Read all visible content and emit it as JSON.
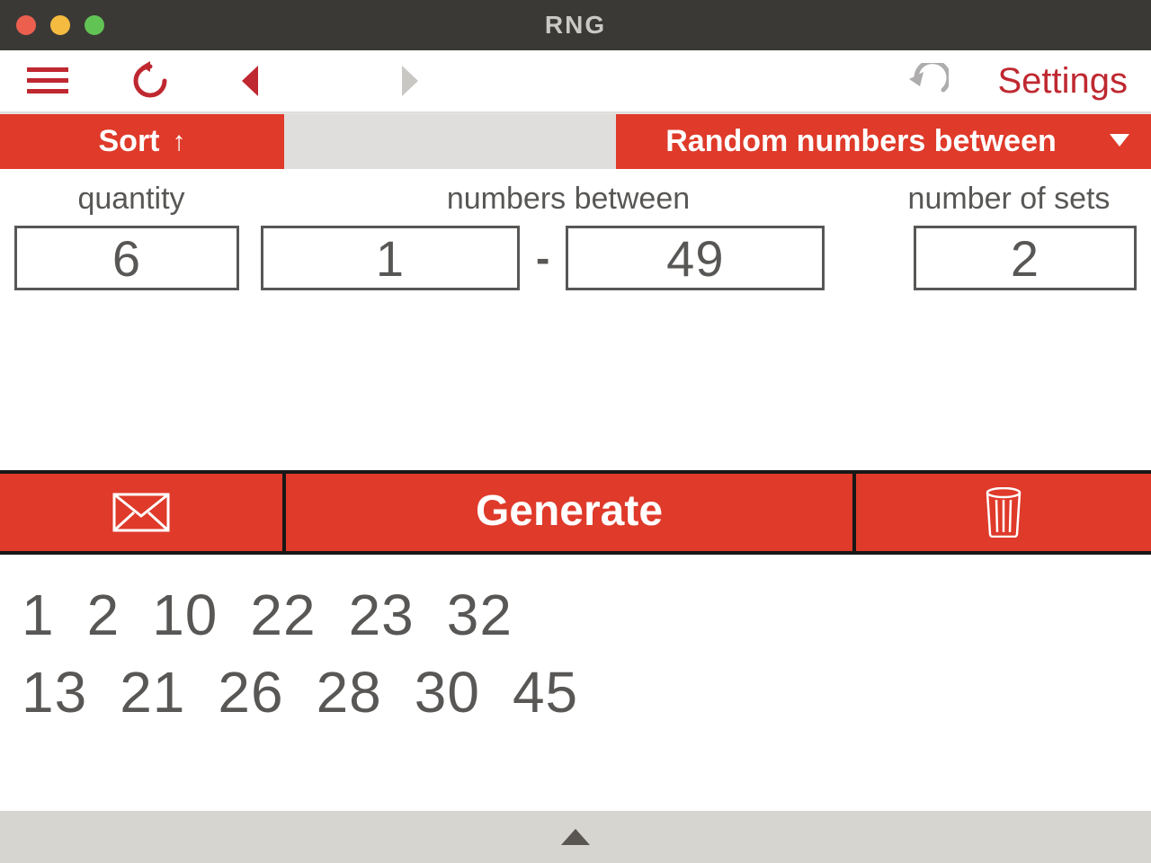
{
  "window": {
    "title": "RNG"
  },
  "toolbar": {
    "settings_label": "Settings"
  },
  "tabs": {
    "sort_label": "Sort",
    "mode_label": "Random numbers between"
  },
  "labels": {
    "quantity": "quantity",
    "between": "numbers between",
    "sets": "number of sets"
  },
  "inputs": {
    "quantity": "6",
    "min": "1",
    "max": "49",
    "sets": "2"
  },
  "actions": {
    "generate_label": "Generate"
  },
  "results": {
    "sets": [
      [
        1,
        2,
        10,
        22,
        23,
        32
      ],
      [
        13,
        21,
        26,
        28,
        30,
        45
      ]
    ]
  },
  "colors": {
    "accent": "#df3a2a",
    "accent_dark": "#bf2830",
    "text_muted": "#585755"
  }
}
